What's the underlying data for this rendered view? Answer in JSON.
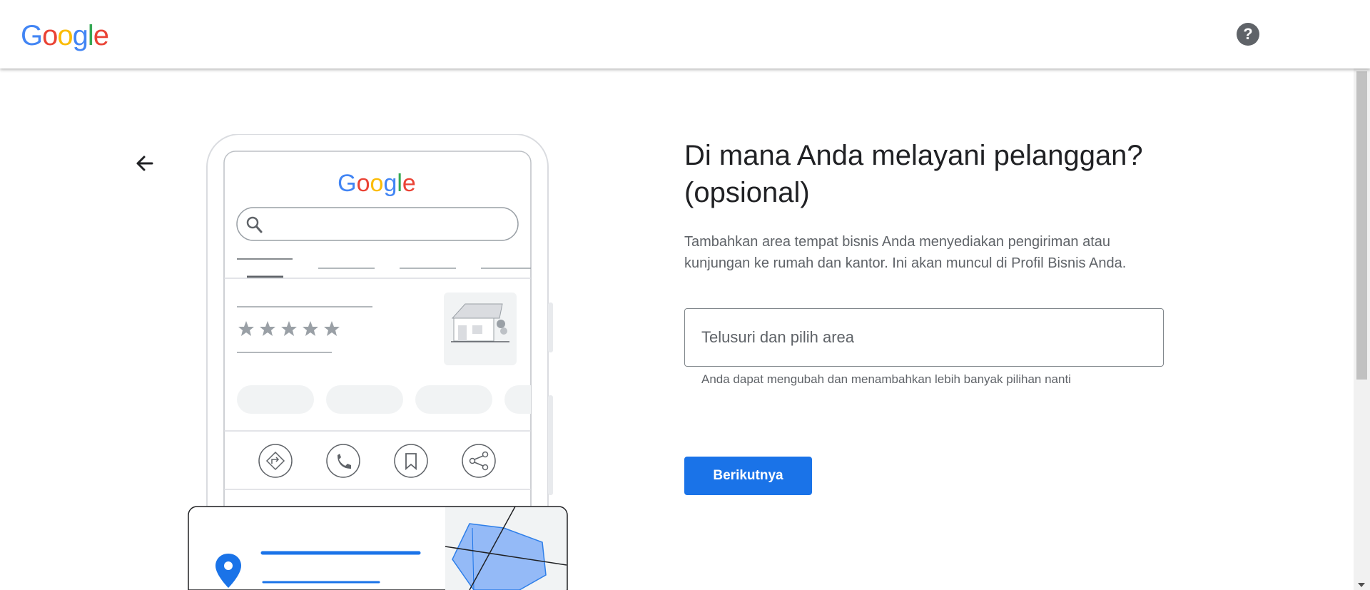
{
  "header": {
    "logo_letters": [
      {
        "char": "G",
        "color": "#4285F4"
      },
      {
        "char": "o",
        "color": "#EA4335"
      },
      {
        "char": "o",
        "color": "#FBBC05"
      },
      {
        "char": "g",
        "color": "#4285F4"
      },
      {
        "char": "l",
        "color": "#34A853"
      },
      {
        "char": "e",
        "color": "#EA4335"
      }
    ],
    "help_icon": "help-circle-icon",
    "help_glyph": "?"
  },
  "illustration": {
    "logo_text": "Google",
    "rating_stars": 5,
    "action_icons": [
      "directions-icon",
      "phone-icon",
      "bookmark-icon",
      "share-icon"
    ]
  },
  "main": {
    "heading_line1": "Di mana Anda melayani pelanggan?",
    "heading_line2": "(opsional)",
    "description_line1": "Tambahkan area tempat bisnis Anda menyediakan pengiriman atau",
    "description_line2": "kunjungan ke rumah dan kantor. Ini akan muncul di Profil Bisnis Anda.",
    "search_placeholder": "Telusuri dan pilih area",
    "search_value": "",
    "helper_text": "Anda dapat mengubah dan menambahkan lebih banyak pilihan nanti",
    "next_button": "Berikutnya"
  },
  "colors": {
    "accent": "#1a73e8",
    "text_primary": "#202124",
    "text_secondary": "#5f6368",
    "map_area": "#8ab4f8"
  }
}
